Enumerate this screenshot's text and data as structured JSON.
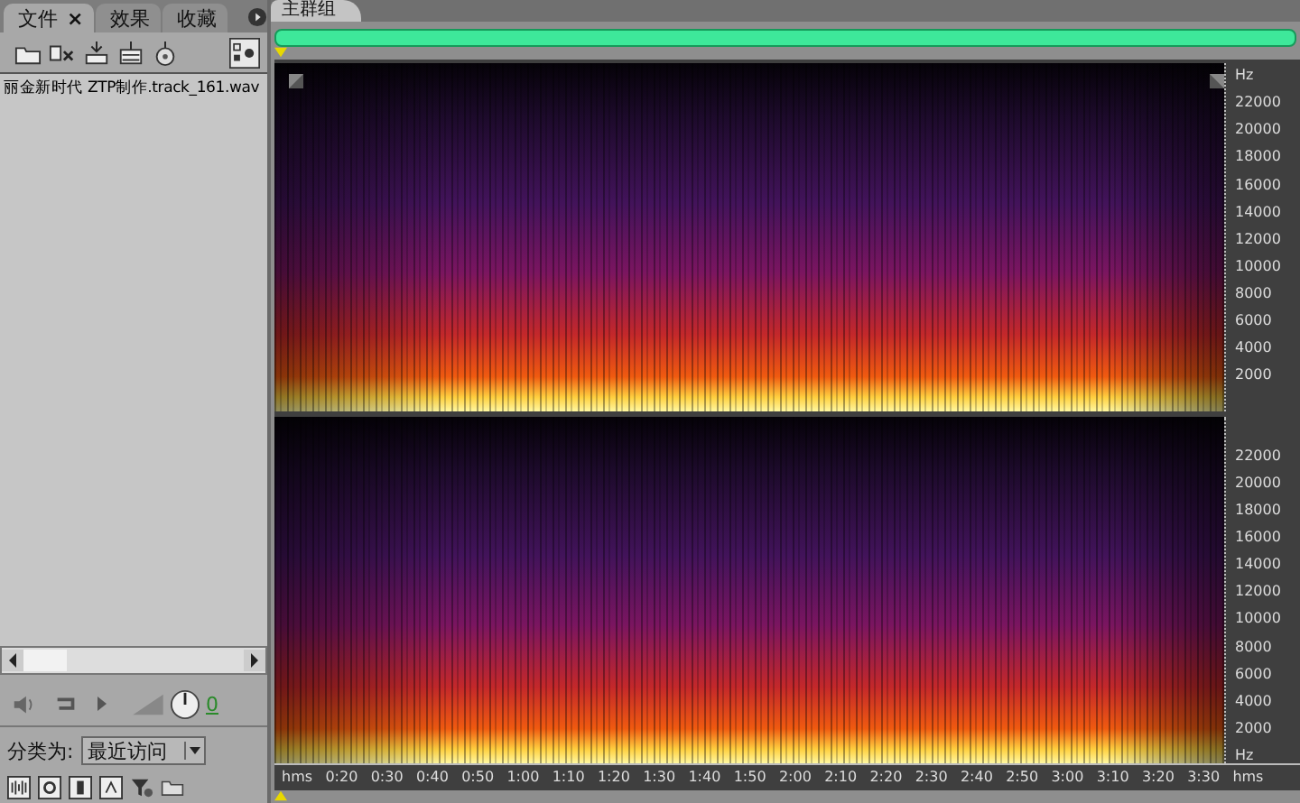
{
  "left_panel": {
    "tabs": [
      {
        "label": "文件",
        "selected": true,
        "close": "×"
      },
      {
        "label": "效果",
        "selected": false
      },
      {
        "label": "收藏",
        "selected": false
      }
    ],
    "files": [
      {
        "name": "丽金新时代 ZTP制作.track_161.wav",
        "selected": false
      }
    ],
    "volume": "0",
    "category": {
      "label": "分类为:",
      "value": "最近访问"
    }
  },
  "main": {
    "tab": {
      "label": "主群组"
    },
    "channels": [
      {
        "unit": "Hz",
        "unit_on_top": true,
        "axis_labels": [
          "22000",
          "20000",
          "18000",
          "16000",
          "14000",
          "12000",
          "10000",
          "8000",
          "6000",
          "4000",
          "2000"
        ]
      },
      {
        "unit": "Hz",
        "unit_on_top": false,
        "axis_labels": [
          "22000",
          "20000",
          "18000",
          "16000",
          "14000",
          "12000",
          "10000",
          "8000",
          "6000",
          "4000",
          "2000"
        ]
      }
    ],
    "time_labels": [
      "hms",
      "0:20",
      "0:30",
      "0:40",
      "0:50",
      "1:00",
      "1:10",
      "1:20",
      "1:30",
      "1:40",
      "1:50",
      "2:00",
      "2:10",
      "2:20",
      "2:30",
      "2:40",
      "2:50",
      "3:00",
      "3:10",
      "3:20",
      "3:30",
      "hms"
    ]
  }
}
